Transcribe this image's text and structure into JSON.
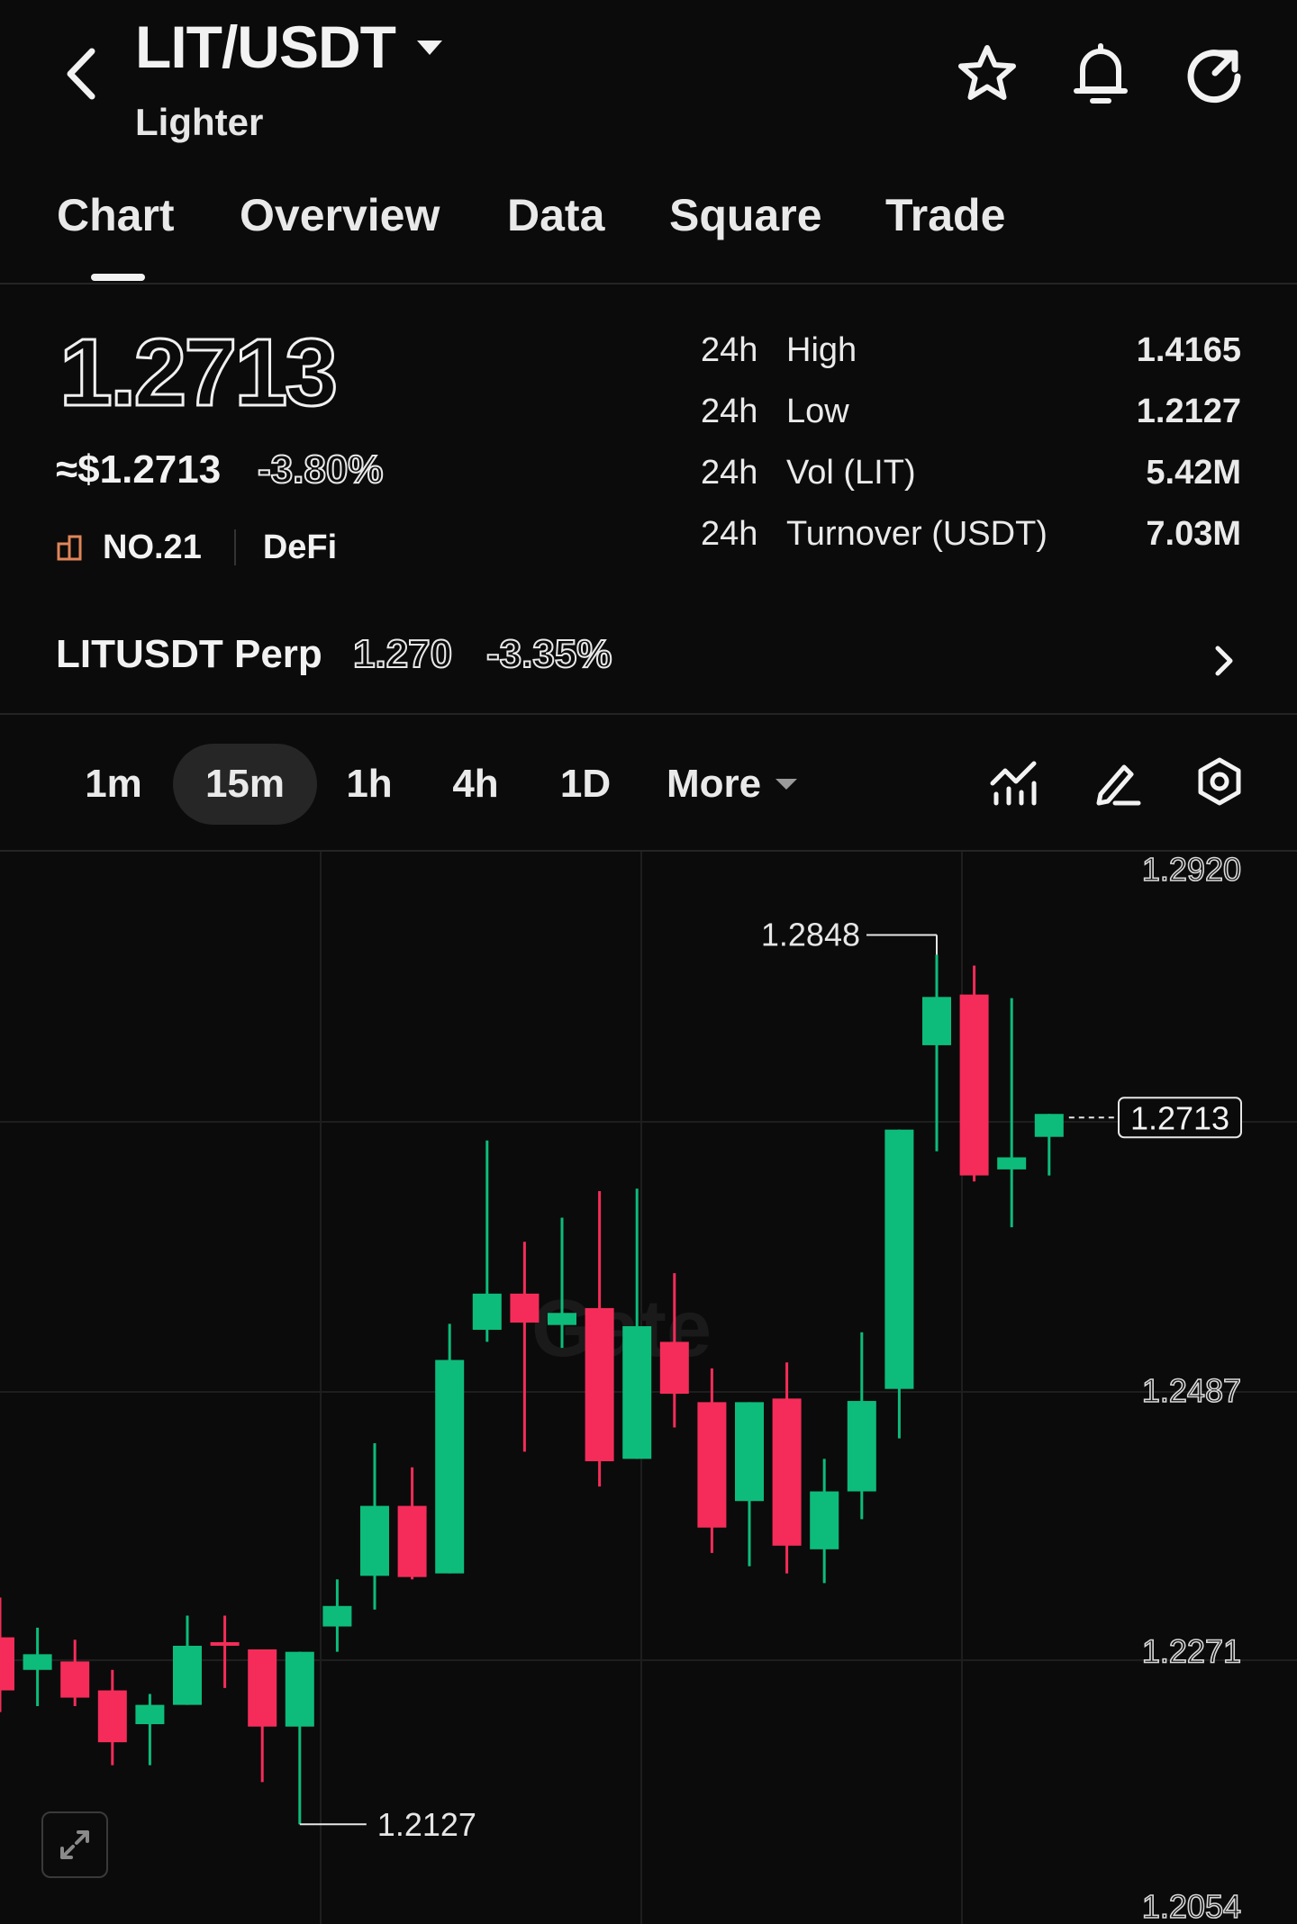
{
  "header": {
    "pair": "LIT/USDT",
    "subtitle": "Lighter"
  },
  "tabs": [
    {
      "label": "Chart",
      "active": true
    },
    {
      "label": "Overview"
    },
    {
      "label": "Data"
    },
    {
      "label": "Square"
    },
    {
      "label": "Trade"
    }
  ],
  "price": {
    "last": "1.2713",
    "usd": "≈$1.2713",
    "change": "-3.80%",
    "rank": "NO.21",
    "category": "DeFi"
  },
  "stats": [
    {
      "period": "24h",
      "label": "High",
      "value": "1.4165"
    },
    {
      "period": "24h",
      "label": "Low",
      "value": "1.2127"
    },
    {
      "period": "24h",
      "label": "Vol (LIT)",
      "value": "5.42M"
    },
    {
      "period": "24h",
      "label": "Turnover (USDT)",
      "value": "7.03M"
    }
  ],
  "perp": {
    "name": "LITUSDT Perp",
    "price": "1.270",
    "change": "-3.35%"
  },
  "timeframes": [
    "1m",
    "15m",
    "1h",
    "4h",
    "1D"
  ],
  "active_timeframe": "15m",
  "more_label": "More",
  "colors": {
    "up": "#0dbc7b",
    "down": "#f52c59",
    "rank_icon": "#e0855a",
    "background": "#0b0b0b"
  },
  "icons": [
    "back-arrow-icon",
    "dropdown-caret-icon",
    "star-icon",
    "bell-icon",
    "share-icon",
    "indicators-icon",
    "draw-icon",
    "settings-icon",
    "expand-icon",
    "chevron-right-icon"
  ],
  "chart_data": {
    "type": "candlestick",
    "y_ticks": [
      "1.2920",
      "1.2487",
      "1.2271",
      "1.2054"
    ],
    "ylim": [
      1.2054,
      1.292
    ],
    "current_price_label": "1.2713",
    "high_marker": "1.2848",
    "low_marker": "1.2127",
    "grid": true,
    "candles": [
      {
        "o": 1.2282,
        "h": 1.2315,
        "l": 1.222,
        "c": 1.2238
      },
      {
        "o": 1.2255,
        "h": 1.229,
        "l": 1.2225,
        "c": 1.2268
      },
      {
        "o": 1.2262,
        "h": 1.228,
        "l": 1.2225,
        "c": 1.2232
      },
      {
        "o": 1.2238,
        "h": 1.2255,
        "l": 1.2176,
        "c": 1.2195
      },
      {
        "o": 1.221,
        "h": 1.2235,
        "l": 1.2176,
        "c": 1.2226
      },
      {
        "o": 1.2226,
        "h": 1.23,
        "l": 1.2226,
        "c": 1.2275
      },
      {
        "o": 1.2278,
        "h": 1.23,
        "l": 1.224,
        "c": 1.2275
      },
      {
        "o": 1.2272,
        "h": 1.2272,
        "l": 1.2162,
        "c": 1.2208
      },
      {
        "o": 1.2208,
        "h": 1.227,
        "l": 1.2127,
        "c": 1.227
      },
      {
        "o": 1.2291,
        "h": 1.233,
        "l": 1.227,
        "c": 1.2308
      },
      {
        "o": 1.2333,
        "h": 1.2443,
        "l": 1.2305,
        "c": 1.2391
      },
      {
        "o": 1.2391,
        "h": 1.2423,
        "l": 1.233,
        "c": 1.2332
      },
      {
        "o": 1.2335,
        "h": 1.2542,
        "l": 1.2335,
        "c": 1.2512
      },
      {
        "o": 1.2537,
        "h": 1.2694,
        "l": 1.2527,
        "c": 1.2567
      },
      {
        "o": 1.2567,
        "h": 1.261,
        "l": 1.2436,
        "c": 1.2543
      },
      {
        "o": 1.2541,
        "h": 1.263,
        "l": 1.2522,
        "c": 1.2551
      },
      {
        "o": 1.2555,
        "h": 1.2652,
        "l": 1.2407,
        "c": 1.2428
      },
      {
        "o": 1.243,
        "h": 1.2654,
        "l": 1.243,
        "c": 1.254
      },
      {
        "o": 1.2527,
        "h": 1.2584,
        "l": 1.2456,
        "c": 1.2484
      },
      {
        "o": 1.2477,
        "h": 1.2505,
        "l": 1.2352,
        "c": 1.2373
      },
      {
        "o": 1.2395,
        "h": 1.2477,
        "l": 1.2341,
        "c": 1.2477
      },
      {
        "o": 1.248,
        "h": 1.251,
        "l": 1.2335,
        "c": 1.2358
      },
      {
        "o": 1.2355,
        "h": 1.243,
        "l": 1.2327,
        "c": 1.2403
      },
      {
        "o": 1.2403,
        "h": 1.2535,
        "l": 1.238,
        "c": 1.2478
      },
      {
        "o": 1.2488,
        "h": 1.2703,
        "l": 1.2447,
        "c": 1.2703
      },
      {
        "o": 1.2773,
        "h": 1.2848,
        "l": 1.2685,
        "c": 1.2813
      },
      {
        "o": 1.2815,
        "h": 1.2839,
        "l": 1.266,
        "c": 1.2665
      },
      {
        "o": 1.267,
        "h": 1.2812,
        "l": 1.2622,
        "c": 1.268
      },
      {
        "o": 1.2697,
        "h": 1.2716,
        "l": 1.2665,
        "c": 1.2716
      }
    ]
  }
}
